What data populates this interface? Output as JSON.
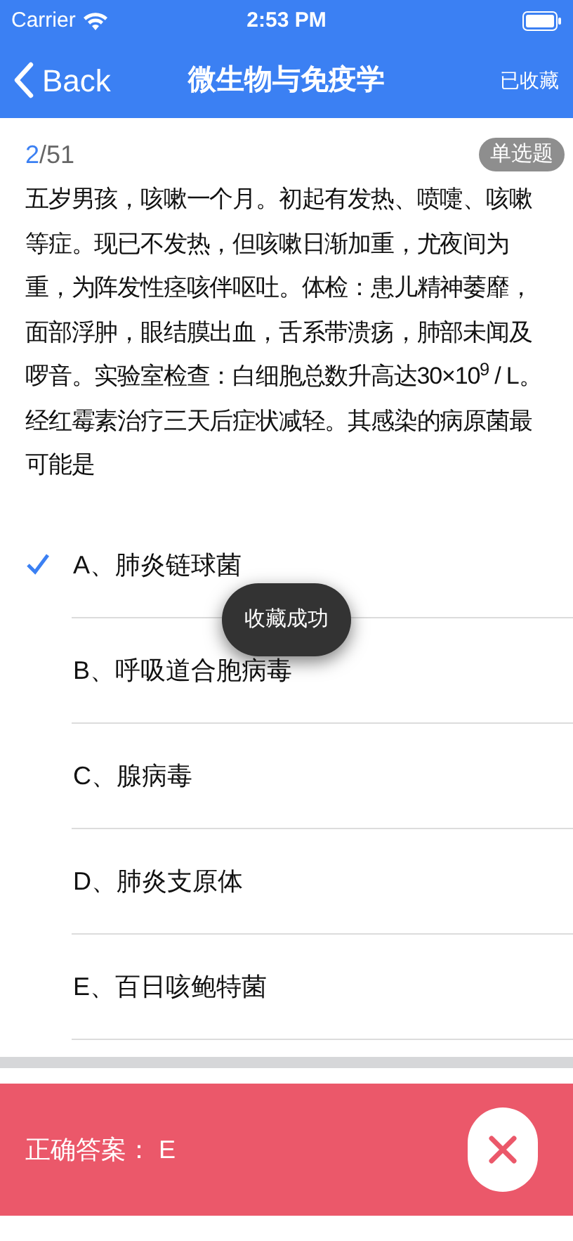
{
  "status_bar": {
    "carrier": "Carrier",
    "time": "2:53 PM"
  },
  "nav": {
    "back": "Back",
    "title": "微生物与免疫学",
    "action": "已收藏"
  },
  "progress": {
    "current": "2",
    "total": "/51",
    "type": "单选题"
  },
  "question": "五岁男孩，咳嗽一个月。初起有发热、喷嚏、咳嗽等症。现已不发热，但咳嗽日渐加重，尤夜间为重，为阵发性痉咳伴呕吐。体检：患儿精神萎靡，面部浮肿，眼结膜出血，舌系带溃疡，肺部未闻及啰音。实验室检查：白细胞总数升高达30×10$^{9}$ / L。经红霉素治疗三天后症状减轻。其感染的病原菌最可能是",
  "options": [
    {
      "label": "A、肺炎链球菌",
      "selected": true
    },
    {
      "label": "B、呼吸道合胞病毒",
      "selected": false
    },
    {
      "label": "C、腺病毒",
      "selected": false
    },
    {
      "label": "D、肺炎支原体",
      "selected": false
    },
    {
      "label": "E、百日咳鲍特菌",
      "selected": false
    }
  ],
  "toast": "收藏成功",
  "result": {
    "text": "正确答案： E",
    "correct": false
  }
}
